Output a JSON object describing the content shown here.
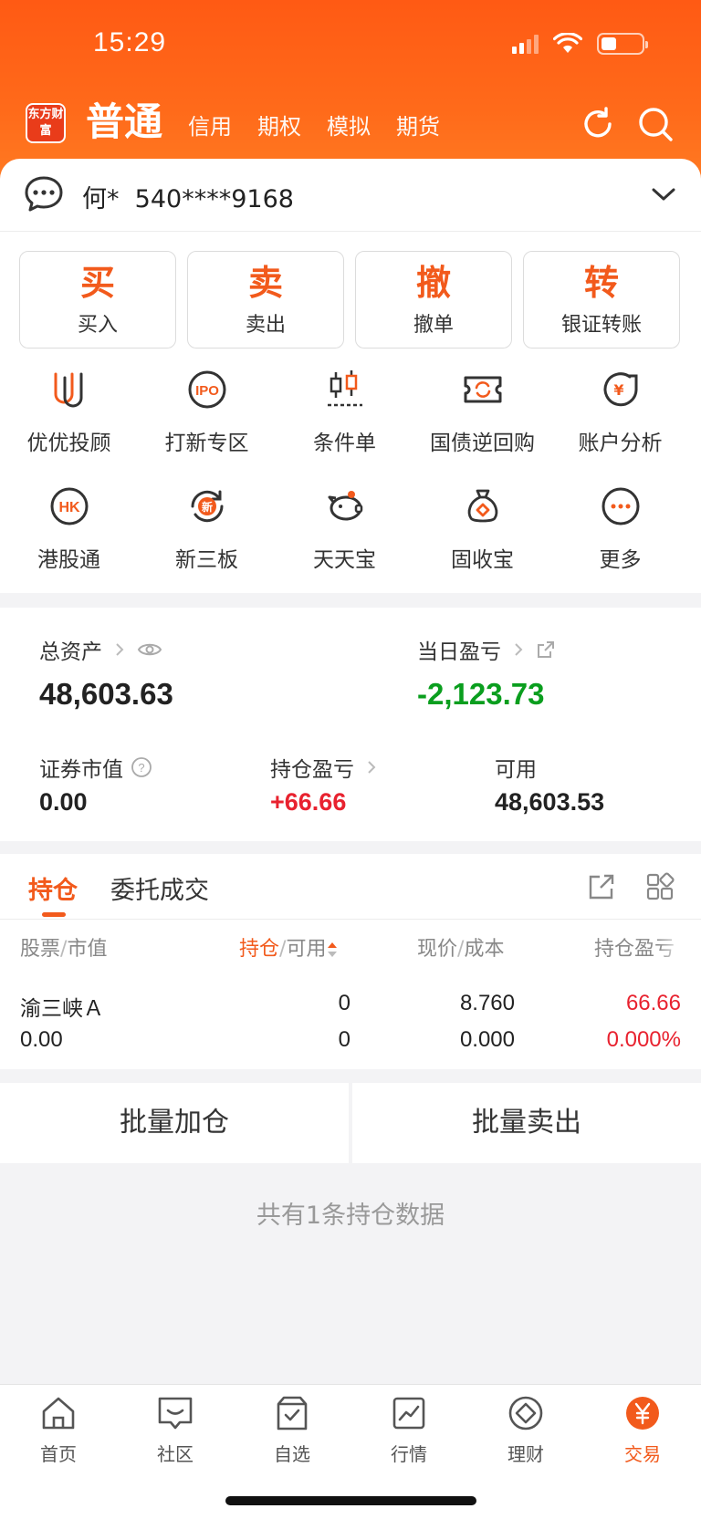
{
  "status_bar": {
    "time": "15:29"
  },
  "header": {
    "logo_text": "东方财富",
    "tabs": [
      {
        "label": "普通",
        "active": true
      },
      {
        "label": "信用"
      },
      {
        "label": "期权"
      },
      {
        "label": "模拟"
      },
      {
        "label": "期货"
      }
    ],
    "icons": [
      "refresh-icon",
      "search-icon"
    ]
  },
  "account": {
    "name": "何*",
    "number": "540****9168"
  },
  "actions": [
    {
      "big": "买",
      "label": "买入"
    },
    {
      "big": "卖",
      "label": "卖出"
    },
    {
      "big": "撤",
      "label": "撤单"
    },
    {
      "big": "转",
      "label": "银证转账"
    }
  ],
  "shortcuts": [
    {
      "label": "优优投顾",
      "icon": "uu-advisor-icon"
    },
    {
      "label": "打新专区",
      "icon": "ipo-icon"
    },
    {
      "label": "条件单",
      "icon": "candlestick-icon"
    },
    {
      "label": "国债逆回购",
      "icon": "repo-ticket-icon"
    },
    {
      "label": "账户分析",
      "icon": "account-analysis-icon"
    },
    {
      "label": "港股通",
      "icon": "hk-icon"
    },
    {
      "label": "新三板",
      "icon": "new-third-board-icon"
    },
    {
      "label": "天天宝",
      "icon": "piggy-bank-icon"
    },
    {
      "label": "固收宝",
      "icon": "money-bag-icon"
    },
    {
      "label": "更多",
      "icon": "more-icon"
    }
  ],
  "assets": {
    "total_label": "总资产",
    "total_value": "48,603.63",
    "daily_pl_label": "当日盈亏",
    "daily_pl_value": "-2,123.73",
    "market_value_label": "证券市值",
    "market_value": "0.00",
    "position_pl_label": "持仓盈亏",
    "position_pl_value": "+66.66",
    "available_label": "可用",
    "available_value": "48,603.53"
  },
  "holdings": {
    "tabs": [
      "持仓",
      "委托成交"
    ],
    "columns": {
      "stock": "股票",
      "market_value": "市值",
      "position": "持仓",
      "available": "可用",
      "price": "现价",
      "cost": "成本",
      "pl": "持仓盈亏"
    },
    "rows": [
      {
        "name": "渝三峡Ａ",
        "market_value": "0.00",
        "position": "0",
        "available": "0",
        "price": "8.760",
        "cost": "0.000",
        "pl": "66.66",
        "pl_pct": "0.000%"
      }
    ]
  },
  "batch": {
    "add": "批量加仓",
    "sell": "批量卖出"
  },
  "note": "共有1条持仓数据",
  "bottom_nav": [
    {
      "label": "首页",
      "icon": "home-icon"
    },
    {
      "label": "社区",
      "icon": "community-icon"
    },
    {
      "label": "自选",
      "icon": "watchlist-icon"
    },
    {
      "label": "行情",
      "icon": "market-chart-icon"
    },
    {
      "label": "理财",
      "icon": "wealth-icon"
    },
    {
      "label": "交易",
      "icon": "trade-yuan-icon",
      "active": true
    }
  ],
  "colors": {
    "accent": "#f25a1c",
    "up": "#e8222f",
    "down": "#0a9e1e"
  }
}
